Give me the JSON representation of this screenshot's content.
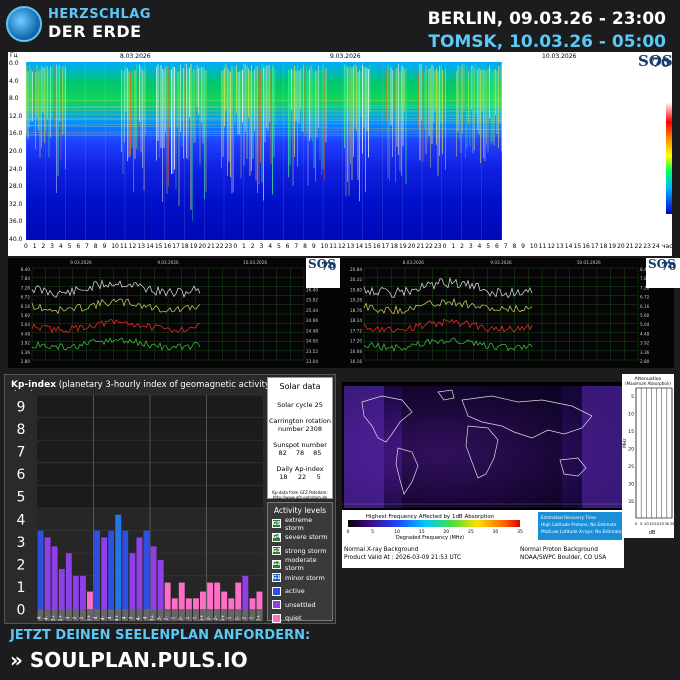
{
  "header": {
    "brand_line1": "HERZSCHLAG",
    "brand_line2": "DER ERDE",
    "berlin": "BERLIN, 09.03.26 - 23:00",
    "tomsk": "TOMSK, 10.03.26 - 05:00"
  },
  "spectrogram": {
    "y_unit": "Гц",
    "y_ticks": [
      "0.0",
      "4.0",
      "8.0",
      "12.0",
      "16.0",
      "20.0",
      "24.0",
      "28.0",
      "32.0",
      "36.0",
      "40.0"
    ],
    "date_labels": [
      "8.03.2026",
      "9.03.2026",
      "10.03.2026"
    ],
    "x_hours": [
      "0",
      "1",
      "2",
      "3",
      "4",
      "5",
      "6",
      "7",
      "8",
      "9",
      "10",
      "11",
      "12",
      "13",
      "14",
      "15",
      "16",
      "17",
      "18",
      "19",
      "20",
      "21",
      "22",
      "23",
      "0",
      "1",
      "2",
      "3",
      "4",
      "5",
      "6",
      "7",
      "8",
      "9",
      "10",
      "11",
      "12",
      "13",
      "14",
      "15",
      "16",
      "17",
      "18",
      "19",
      "20",
      "21",
      "22",
      "23",
      "0",
      "1",
      "2",
      "3",
      "4",
      "5",
      "6",
      "7",
      "8",
      "9",
      "10",
      "11",
      "12",
      "13",
      "14",
      "15",
      "16",
      "17",
      "18",
      "19",
      "20",
      "21",
      "22",
      "23",
      "24"
    ],
    "x_unit": "час"
  },
  "sos_badge": {
    "letters": "SOS",
    "number": "70"
  },
  "amp_left": {
    "dates": [
      "9.03.2026",
      "9.03.2026",
      "10.03.2026"
    ],
    "left_ticks": [
      "8.40",
      "7.84",
      "7.28",
      "6.72",
      "6.16",
      "5.60",
      "5.04",
      "4.48",
      "3.92",
      "3.36",
      "2.80"
    ],
    "right_ticks": [
      "27.36",
      "26.88",
      "26.40",
      "25.92",
      "25.44",
      "24.96",
      "24.48",
      "24.00",
      "23.52",
      "23.04"
    ]
  },
  "amp_right": {
    "dates": [
      "8.03.2026",
      "9.03.2026",
      "10.03.2026"
    ],
    "left_ticks": [
      "20.84",
      "20.32",
      "19.80",
      "19.28",
      "18.76",
      "18.24",
      "17.72",
      "17.20",
      "16.68",
      "16.16"
    ],
    "right_ticks": [
      "8.40",
      "7.84",
      "7.28",
      "6.72",
      "6.16",
      "5.60",
      "5.04",
      "4.48",
      "3.92",
      "3.36",
      "2.80"
    ]
  },
  "kp": {
    "title_bold": "Kp-index",
    "title_rest": "(planetary 3-hourly index of geomagnetic activity - provisional data)",
    "y_labels": [
      "9",
      "8",
      "7",
      "6",
      "5",
      "4",
      "3",
      "2",
      "1",
      "0"
    ],
    "days": [
      "7 Mar 2026",
      "8 Mar 2026",
      "9 Mar 2026"
    ],
    "values": [
      4.0,
      3.7,
      3.3,
      2.3,
      3.0,
      2.0,
      2.0,
      1.3,
      4.0,
      3.7,
      4.0,
      4.7,
      4.0,
      3.0,
      3.7,
      4.0,
      3.3,
      2.7,
      1.7,
      1.0,
      1.7,
      1.0,
      1.0,
      1.3,
      1.7,
      1.7,
      1.3,
      1.0,
      1.7,
      2.0,
      1.0,
      1.3
    ],
    "bar_labels": [
      "4",
      "4-",
      "3+",
      "2+",
      "3",
      "2",
      "2",
      "1+",
      "4",
      "4-",
      "4",
      "4+",
      "4",
      "3",
      "4-",
      "4",
      "3+",
      "3-",
      "2-",
      "1",
      "2-",
      "1",
      "1",
      "1+",
      "2-",
      "2-",
      "1+",
      "1",
      "2-",
      "2",
      "1",
      "1+"
    ]
  },
  "solar": {
    "title": "Solar data",
    "cycle": "Solar cycle 25",
    "carrington_label": "Carrington rotation",
    "carrington_value": "number 2308",
    "sunspot_label": "Sunspot number",
    "sunspot_values": [
      "82",
      "78",
      "85"
    ],
    "ap_label": "Daily Ap-index",
    "ap_values": [
      "18",
      "22",
      "5"
    ],
    "source_line1": "Kp-data from GFZ Potsdam:",
    "source_line2": "http://www.gfz-potsdam.de"
  },
  "activity": {
    "title": "Activity levels",
    "levels": [
      {
        "badge": "G5",
        "label": "extreme storm",
        "color": "#2e7d32"
      },
      {
        "badge": "G4",
        "label": "severe storm",
        "color": "#2e7d32"
      },
      {
        "badge": "G3",
        "label": "strong storm",
        "color": "#2e7d32"
      },
      {
        "badge": "G2",
        "label": "moderate storm",
        "color": "#2e7d32"
      },
      {
        "badge": "G1",
        "label": "minor storm",
        "color": "#1565c0"
      },
      {
        "badge": "",
        "label": "active",
        "color": "#2f4fe0"
      },
      {
        "badge": "",
        "label": "unsettled",
        "color": "#8e3fe8"
      },
      {
        "badge": "",
        "label": "quiet",
        "color": "#ff6fc8"
      }
    ]
  },
  "drap": {
    "colorbar_title": "Highest Frequency Affected by 1dB Absorption",
    "colorbar_ticks": [
      "0",
      "5",
      "10",
      "15",
      "20",
      "25",
      "30",
      "35"
    ],
    "colorbar_unit": "Degraded Frequency (MHz)",
    "recovery_lines": [
      "Estimated Recovery Time",
      "High Latitude Protons: No Estimate",
      "Mid/Low Latitude X-rays: No Estimate"
    ],
    "status_xray": "Normal X-ray Background",
    "status_valid": "Product Valid At : 2026-03-09 21:53 UTC",
    "status_proton": "Normal Proton Background",
    "status_source": "NOAA/SWPC Boulder, CO USA"
  },
  "attenuation": {
    "title1": "Attenuation",
    "title2": "(Maximum Absorption)",
    "y_ticks": [
      "5",
      "10",
      "15",
      "20",
      "25",
      "30",
      "35"
    ],
    "y_unit": "MHz",
    "x_ticks": [
      "0",
      "5",
      "10",
      "15",
      "20",
      "25",
      "30",
      "35"
    ],
    "x_unit": "dB"
  },
  "footer": {
    "line1": "JETZT DEINEN SEELENPLAN ANFORDERN:",
    "line2": "» SOULPLAN.PULS.IO"
  },
  "colors": {
    "accent": "#5cc8f5",
    "background": "#1c1c1e",
    "active": "#2f4fe0",
    "unsettled": "#8e3fe8",
    "quiet": "#ff6fc8"
  }
}
